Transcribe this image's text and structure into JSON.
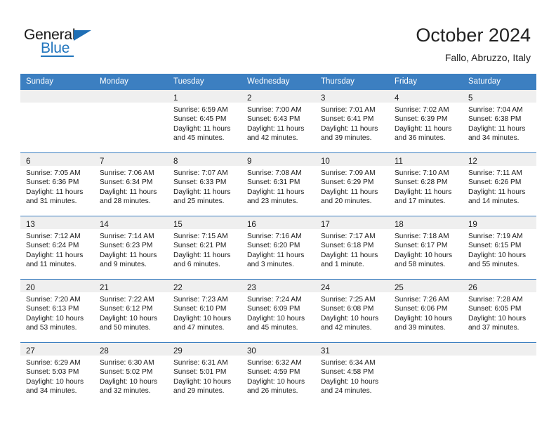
{
  "brand": {
    "name_top": "General",
    "name_bottom": "Blue",
    "accent_color": "#2175bd"
  },
  "header": {
    "title": "October 2024",
    "subtitle": "Fallo, Abruzzo, Italy",
    "header_bg": "#3c7fc1",
    "daynum_bg": "#efefef"
  },
  "weekdays": [
    "Sunday",
    "Monday",
    "Tuesday",
    "Wednesday",
    "Thursday",
    "Friday",
    "Saturday"
  ],
  "labels": {
    "sunrise": "Sunrise:",
    "sunset": "Sunset:",
    "daylight": "Daylight:"
  },
  "weeks": [
    [
      {
        "day": ""
      },
      {
        "day": ""
      },
      {
        "day": "1",
        "sunrise": "Sunrise: 6:59 AM",
        "sunset": "Sunset: 6:45 PM",
        "daylight": "Daylight: 11 hours and 45 minutes."
      },
      {
        "day": "2",
        "sunrise": "Sunrise: 7:00 AM",
        "sunset": "Sunset: 6:43 PM",
        "daylight": "Daylight: 11 hours and 42 minutes."
      },
      {
        "day": "3",
        "sunrise": "Sunrise: 7:01 AM",
        "sunset": "Sunset: 6:41 PM",
        "daylight": "Daylight: 11 hours and 39 minutes."
      },
      {
        "day": "4",
        "sunrise": "Sunrise: 7:02 AM",
        "sunset": "Sunset: 6:39 PM",
        "daylight": "Daylight: 11 hours and 36 minutes."
      },
      {
        "day": "5",
        "sunrise": "Sunrise: 7:04 AM",
        "sunset": "Sunset: 6:38 PM",
        "daylight": "Daylight: 11 hours and 34 minutes."
      }
    ],
    [
      {
        "day": "6",
        "sunrise": "Sunrise: 7:05 AM",
        "sunset": "Sunset: 6:36 PM",
        "daylight": "Daylight: 11 hours and 31 minutes."
      },
      {
        "day": "7",
        "sunrise": "Sunrise: 7:06 AM",
        "sunset": "Sunset: 6:34 PM",
        "daylight": "Daylight: 11 hours and 28 minutes."
      },
      {
        "day": "8",
        "sunrise": "Sunrise: 7:07 AM",
        "sunset": "Sunset: 6:33 PM",
        "daylight": "Daylight: 11 hours and 25 minutes."
      },
      {
        "day": "9",
        "sunrise": "Sunrise: 7:08 AM",
        "sunset": "Sunset: 6:31 PM",
        "daylight": "Daylight: 11 hours and 23 minutes."
      },
      {
        "day": "10",
        "sunrise": "Sunrise: 7:09 AM",
        "sunset": "Sunset: 6:29 PM",
        "daylight": "Daylight: 11 hours and 20 minutes."
      },
      {
        "day": "11",
        "sunrise": "Sunrise: 7:10 AM",
        "sunset": "Sunset: 6:28 PM",
        "daylight": "Daylight: 11 hours and 17 minutes."
      },
      {
        "day": "12",
        "sunrise": "Sunrise: 7:11 AM",
        "sunset": "Sunset: 6:26 PM",
        "daylight": "Daylight: 11 hours and 14 minutes."
      }
    ],
    [
      {
        "day": "13",
        "sunrise": "Sunrise: 7:12 AM",
        "sunset": "Sunset: 6:24 PM",
        "daylight": "Daylight: 11 hours and 11 minutes."
      },
      {
        "day": "14",
        "sunrise": "Sunrise: 7:14 AM",
        "sunset": "Sunset: 6:23 PM",
        "daylight": "Daylight: 11 hours and 9 minutes."
      },
      {
        "day": "15",
        "sunrise": "Sunrise: 7:15 AM",
        "sunset": "Sunset: 6:21 PM",
        "daylight": "Daylight: 11 hours and 6 minutes."
      },
      {
        "day": "16",
        "sunrise": "Sunrise: 7:16 AM",
        "sunset": "Sunset: 6:20 PM",
        "daylight": "Daylight: 11 hours and 3 minutes."
      },
      {
        "day": "17",
        "sunrise": "Sunrise: 7:17 AM",
        "sunset": "Sunset: 6:18 PM",
        "daylight": "Daylight: 11 hours and 1 minute."
      },
      {
        "day": "18",
        "sunrise": "Sunrise: 7:18 AM",
        "sunset": "Sunset: 6:17 PM",
        "daylight": "Daylight: 10 hours and 58 minutes."
      },
      {
        "day": "19",
        "sunrise": "Sunrise: 7:19 AM",
        "sunset": "Sunset: 6:15 PM",
        "daylight": "Daylight: 10 hours and 55 minutes."
      }
    ],
    [
      {
        "day": "20",
        "sunrise": "Sunrise: 7:20 AM",
        "sunset": "Sunset: 6:13 PM",
        "daylight": "Daylight: 10 hours and 53 minutes."
      },
      {
        "day": "21",
        "sunrise": "Sunrise: 7:22 AM",
        "sunset": "Sunset: 6:12 PM",
        "daylight": "Daylight: 10 hours and 50 minutes."
      },
      {
        "day": "22",
        "sunrise": "Sunrise: 7:23 AM",
        "sunset": "Sunset: 6:10 PM",
        "daylight": "Daylight: 10 hours and 47 minutes."
      },
      {
        "day": "23",
        "sunrise": "Sunrise: 7:24 AM",
        "sunset": "Sunset: 6:09 PM",
        "daylight": "Daylight: 10 hours and 45 minutes."
      },
      {
        "day": "24",
        "sunrise": "Sunrise: 7:25 AM",
        "sunset": "Sunset: 6:08 PM",
        "daylight": "Daylight: 10 hours and 42 minutes."
      },
      {
        "day": "25",
        "sunrise": "Sunrise: 7:26 AM",
        "sunset": "Sunset: 6:06 PM",
        "daylight": "Daylight: 10 hours and 39 minutes."
      },
      {
        "day": "26",
        "sunrise": "Sunrise: 7:28 AM",
        "sunset": "Sunset: 6:05 PM",
        "daylight": "Daylight: 10 hours and 37 minutes."
      }
    ],
    [
      {
        "day": "27",
        "sunrise": "Sunrise: 6:29 AM",
        "sunset": "Sunset: 5:03 PM",
        "daylight": "Daylight: 10 hours and 34 minutes."
      },
      {
        "day": "28",
        "sunrise": "Sunrise: 6:30 AM",
        "sunset": "Sunset: 5:02 PM",
        "daylight": "Daylight: 10 hours and 32 minutes."
      },
      {
        "day": "29",
        "sunrise": "Sunrise: 6:31 AM",
        "sunset": "Sunset: 5:01 PM",
        "daylight": "Daylight: 10 hours and 29 minutes."
      },
      {
        "day": "30",
        "sunrise": "Sunrise: 6:32 AM",
        "sunset": "Sunset: 4:59 PM",
        "daylight": "Daylight: 10 hours and 26 minutes."
      },
      {
        "day": "31",
        "sunrise": "Sunrise: 6:34 AM",
        "sunset": "Sunset: 4:58 PM",
        "daylight": "Daylight: 10 hours and 24 minutes."
      },
      {
        "day": ""
      },
      {
        "day": ""
      }
    ]
  ]
}
